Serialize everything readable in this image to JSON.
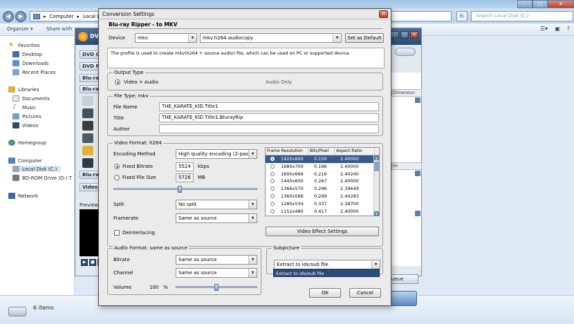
{
  "explorer": {
    "breadcrumb": [
      "Computer",
      "Local Di"
    ],
    "search_placeholder": "Search Local Disk (C:)",
    "toolbar": {
      "organize": "Organize",
      "share_with": "Share with"
    },
    "nav": {
      "favorites": "Favorites",
      "desktop": "Desktop",
      "downloads": "Downloads",
      "recent": "Recent Places",
      "libraries": "Libraries",
      "documents": "Documents",
      "music": "Music",
      "pictures": "Pictures",
      "videos": "Videos",
      "homegroup": "Homegroup",
      "computer": "Computer",
      "local_disk": "Local Disk (C:)",
      "bd_rom": "BD-ROM Drive (D:) T",
      "network": "Network"
    },
    "status_items": "6 items"
  },
  "app": {
    "title": "DVI",
    "left_items": [
      "DVD C",
      "DVD R",
      "Blu-ray",
      "Blu-ray",
      "Video C"
    ],
    "preview_label": "Preview",
    "right_headers": [
      "Dimension",
      "im"
    ],
    "queue_label": "ueue"
  },
  "dialog": {
    "title": "Conversion Settings",
    "subheading": "Blu-ray Ripper - to MKV",
    "device_label": "Device",
    "device_value": "mkv",
    "profile_value": "mkv.h264.audiocopy",
    "set_default": "Set as Default",
    "description": "The profile is used to create mkv(h264 + source audio) file, which can be used on PC or supported device.",
    "output_type": {
      "legend": "Output Type",
      "video_audio": "Video + Audio",
      "audio_only": "Audio Only"
    },
    "file_type": {
      "legend": "File Type: mkv",
      "file_name_label": "File Name",
      "file_name_value": "THE_KARATE_KID.Title1",
      "title_label": "Title",
      "title_value": "THE_KARATE_KID.Title1.BlurayRip",
      "author_label": "Author",
      "author_value": ""
    },
    "video_format": {
      "legend": "Video Format: h264",
      "encoding_label": "Encoding Method",
      "encoding_value": "High quality encoding (2-pass)",
      "fixed_bitrate_label": "Fixed Bitrate",
      "fixed_bitrate_value": "5524",
      "kbps": "kbps",
      "fixed_size_label": "Fixed File Size",
      "fixed_size_value": "5726",
      "mb": "MB",
      "bitrate_slider": 0.46,
      "split_label": "Split",
      "split_value": "No split",
      "framerate_label": "Framerate",
      "framerate_value": "Same as source",
      "deinterlacing_label": "Deinterlacing",
      "effect_button": "Video Effect Settings",
      "table": {
        "headers": [
          "Frame Resolution",
          "Bits/Pixel",
          "Aspect Ratio"
        ],
        "rows": [
          [
            "1920x800",
            "0.150",
            "2.40000"
          ],
          [
            "1680x700",
            "0.196",
            "2.40000"
          ],
          [
            "1600x666",
            "0.216",
            "2.40240"
          ],
          [
            "1440x600",
            "0.267",
            "2.40000"
          ],
          [
            "1366x570",
            "0.296",
            "2.39649"
          ],
          [
            "1360x566",
            "0.299",
            "2.40283"
          ],
          [
            "1280x534",
            "0.337",
            "2.39700"
          ],
          [
            "1152x480",
            "0.417",
            "2.40000"
          ]
        ],
        "selected_index": 0
      }
    },
    "audio_format": {
      "legend": "Audio Format: same as source",
      "bitrate_label": "Bitrate",
      "bitrate_value": "Same as source",
      "channel_label": "Channel",
      "channel_value": "Same as source",
      "volume_label": "Volume",
      "volume_value": "100",
      "percent": "%",
      "volume_slider": 0.5
    },
    "subpicture": {
      "legend": "Subpicture",
      "value": "Extract to idx/sub file",
      "dropdown_option": "Extract to idx/sub file"
    },
    "ok": "OK",
    "cancel": "Cancel"
  }
}
